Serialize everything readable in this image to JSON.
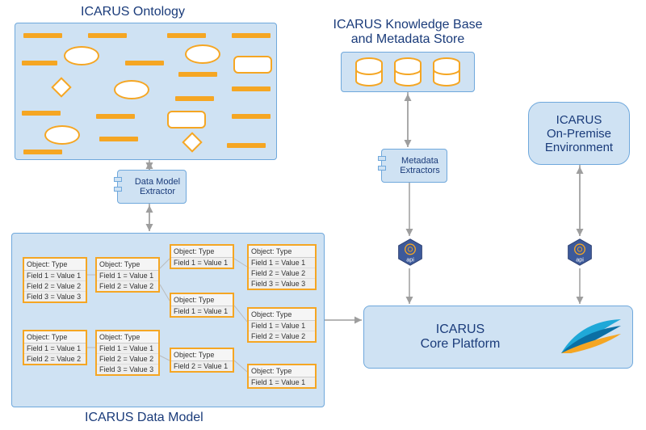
{
  "titles": {
    "ontology": "ICARUS Ontology",
    "knowledge_base_l1": "ICARUS Knowledge Base",
    "knowledge_base_l2": "and Metadata Store",
    "onprem_l1": "ICARUS",
    "onprem_l2": "On-Premise",
    "onprem_l3": "Environment",
    "data_model": "ICARUS Data Model",
    "core_l1": "ICARUS",
    "core_l2": "Core Platform"
  },
  "components": {
    "data_model_extractor_l1": "Data Model",
    "data_model_extractor_l2": "Extractor",
    "metadata_extractors_l1": "Metadata",
    "metadata_extractors_l2": "Extractors"
  },
  "api_label": "api",
  "objects": [
    {
      "id": "o1",
      "header": "Object: Type",
      "fields": [
        "Field 1 = Value 1",
        "Field 2 = Value 2",
        "Field 3 = Value 3"
      ]
    },
    {
      "id": "o2",
      "header": "Object: Type",
      "fields": [
        "Field 1 = Value 1",
        "Field 2 = Value 2"
      ]
    },
    {
      "id": "o3",
      "header": "Object: Type",
      "fields": [
        "Field 1 = Value 1",
        "Field 2 = Value 2"
      ]
    },
    {
      "id": "o4",
      "header": "Object: Type",
      "fields": [
        "Field 1 = Value 1",
        "Field 2 = Value 2",
        "Field 3 = Value 3"
      ]
    },
    {
      "id": "o5",
      "header": "Object: Type",
      "fields": [
        "Field 1 = Value 1"
      ]
    },
    {
      "id": "o6",
      "header": "Object: Type",
      "fields": [
        "Field 1 = Value 1"
      ]
    },
    {
      "id": "o7",
      "header": "Object: Type",
      "fields": [
        "Field 2 = Value 1"
      ]
    },
    {
      "id": "o8",
      "header": "Object: Type",
      "fields": [
        "Field 1 = Value 1",
        "Field 2 = Value 2",
        "Field 3 = Value 3"
      ]
    },
    {
      "id": "o9",
      "header": "Object: Type",
      "fields": [
        "Field 1 = Value 1",
        "Field 2 = Value 2"
      ]
    },
    {
      "id": "o10",
      "header": "Object: Type",
      "fields": [
        "Field 1 = Value 1"
      ]
    }
  ]
}
